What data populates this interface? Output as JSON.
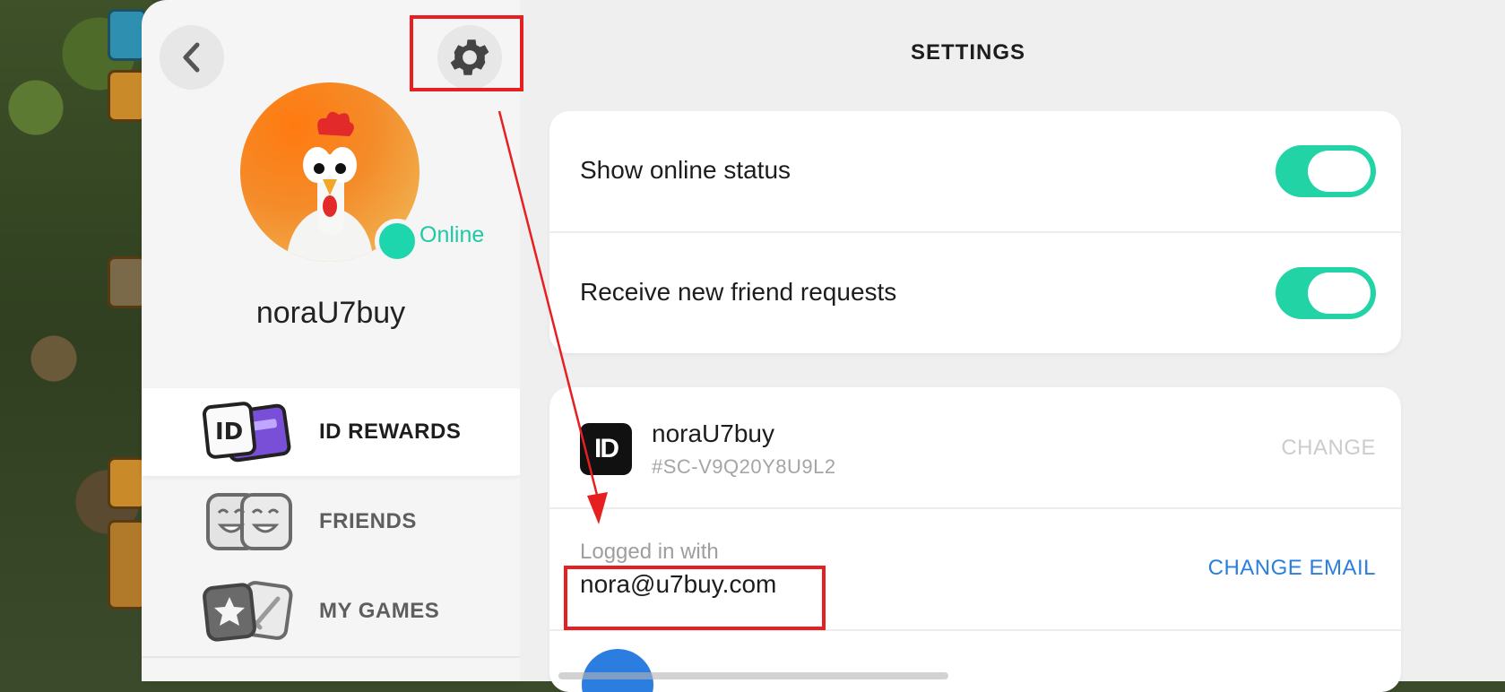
{
  "profile": {
    "username": "noraU7buy",
    "status": "Online",
    "menu": [
      {
        "label": "ID REWARDS",
        "active": true
      },
      {
        "label": "FRIENDS",
        "active": false
      },
      {
        "label": "MY GAMES",
        "active": false
      }
    ]
  },
  "settings": {
    "title": "SETTINGS",
    "toggles": [
      {
        "label": "Show online status",
        "on": true
      },
      {
        "label": "Receive new friend requests",
        "on": true
      }
    ],
    "account": {
      "badge": "ID",
      "name": "noraU7buy",
      "tag": "#SC-V9Q20Y8U9L2",
      "change_label": "CHANGE"
    },
    "login": {
      "label": "Logged in with",
      "email": "nora@u7buy.com",
      "change_email_label": "CHANGE EMAIL"
    }
  },
  "icons": {
    "back": "chevron-left-icon",
    "settings": "gear-icon",
    "id_rewards": "id-card-icon",
    "friends": "friends-faces-icon",
    "games": "star-sword-icon"
  },
  "colors": {
    "accent_green": "#22d3a5",
    "link_blue": "#2a7fdc",
    "annotation_red": "#e62020"
  }
}
